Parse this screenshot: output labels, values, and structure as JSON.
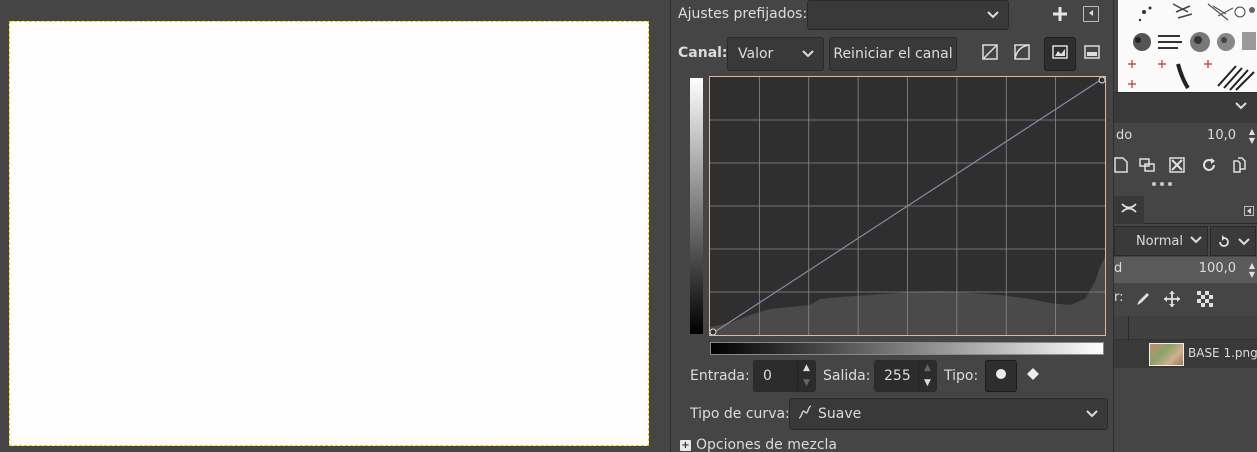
{
  "curves": {
    "presets_label": "Ajustes prefijados:",
    "presets_value": "",
    "channel_label": "Canal:",
    "channel_value": "Valor",
    "reset_channel_label": "Reiniciar el canal",
    "input_label": "Entrada:",
    "input_value": "0",
    "output_label": "Salida:",
    "output_value": "255",
    "type_label": "Tipo:",
    "curve_type_label": "Tipo de curva:",
    "curve_type_value": "Suave",
    "blend_options_label": "Opciones de mezcla",
    "curve_points": [
      [
        0,
        0
      ],
      [
        255,
        255
      ]
    ]
  },
  "dock": {
    "spacing_label": "do",
    "spacing_value": "10,0",
    "mode_value": "Normal",
    "opacity_label": "d",
    "opacity_value": "100,0",
    "lock_label": "r:",
    "layer_name": "BASE 1.png"
  },
  "colors": {
    "accent_selection": "#e6d500",
    "curve_line": "#8a8aa8",
    "histogram_fill": "#4a4a4a",
    "graph_border": "#d7b9a8"
  },
  "icons": {
    "add": "plus-icon",
    "preset_menu": "menu-triangle-icon",
    "linear": "linear-histogram-icon",
    "log": "log-histogram-icon"
  }
}
